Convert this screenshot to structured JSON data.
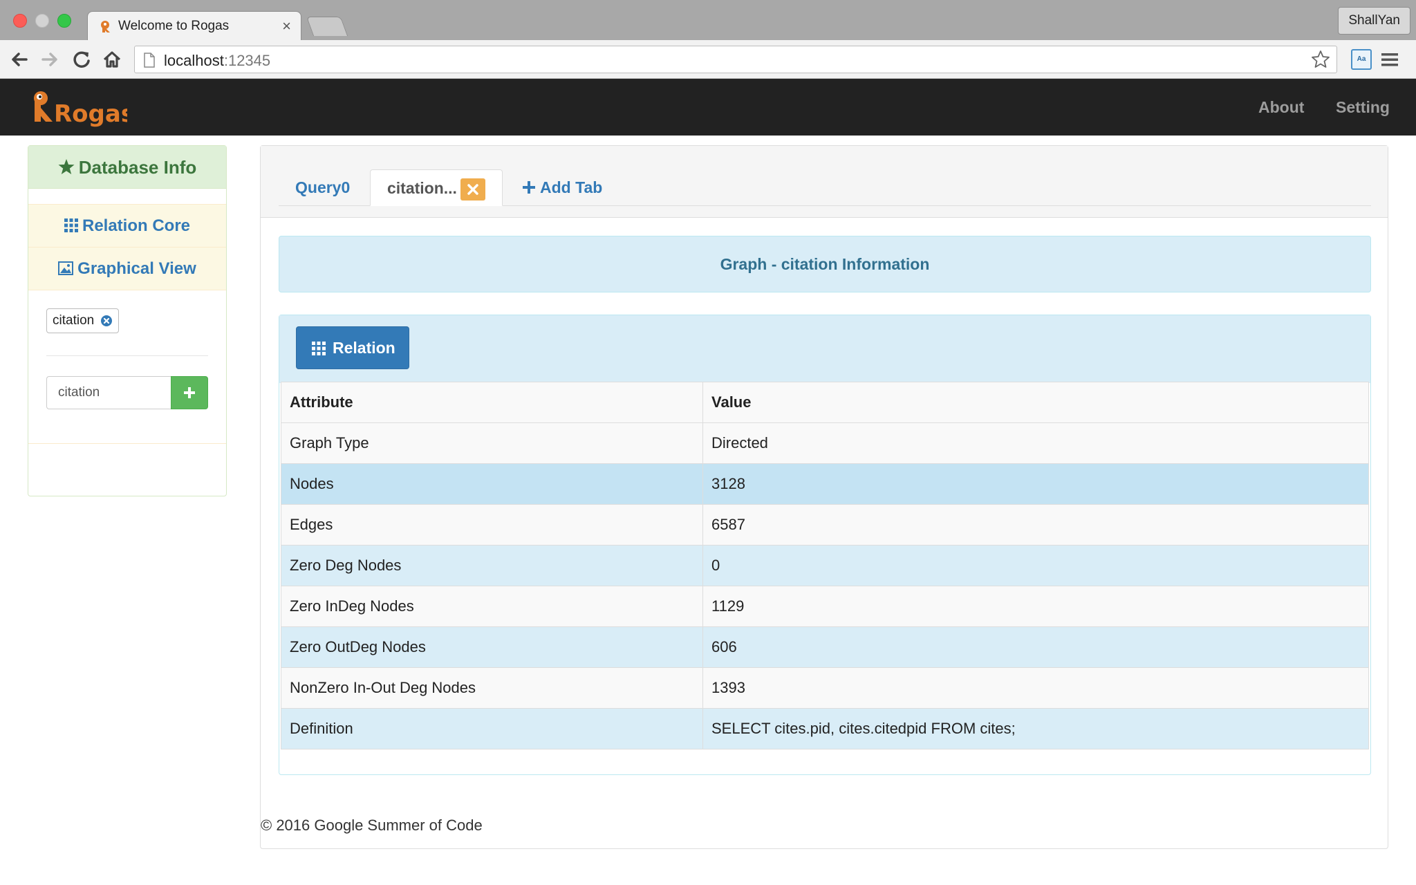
{
  "browser": {
    "tab_title": "Welcome to Rogas",
    "tab_close": "×",
    "profile": "ShallYan",
    "url_host": "localhost",
    "url_port": ":12345",
    "ext_label": "Aa"
  },
  "navbar": {
    "brand": "Rogas",
    "links": [
      "About",
      "Setting"
    ]
  },
  "sidebar": {
    "header": "Database Info",
    "items": [
      "Relation Core",
      "Graphical View"
    ],
    "graph_chip": "citation",
    "input_value": "citation"
  },
  "main": {
    "tabs": {
      "query0": "Query0",
      "citation": "citation...",
      "add": "Add Tab"
    },
    "banner": "Graph - citation Information",
    "relation_button": "Relation",
    "table": {
      "headers": [
        "Attribute",
        "Value"
      ],
      "rows": [
        [
          "Graph Type",
          "Directed"
        ],
        [
          "Nodes",
          "3128"
        ],
        [
          "Edges",
          "6587"
        ],
        [
          "Zero Deg Nodes",
          "0"
        ],
        [
          "Zero InDeg Nodes",
          "1129"
        ],
        [
          "Zero OutDeg Nodes",
          "606"
        ],
        [
          "NonZero In-Out Deg Nodes",
          "1393"
        ],
        [
          "Definition",
          "SELECT cites.pid, cites.citedpid FROM cites;"
        ]
      ]
    },
    "footer": "© 2016 Google Summer of Code"
  },
  "colors": {
    "navbar_bg": "#222222",
    "brand_orange": "#e07b2a",
    "link_blue": "#337ab7",
    "success_green": "#5cb85c",
    "warning_orange": "#f0ad4e",
    "info_bg": "#d9edf7"
  }
}
